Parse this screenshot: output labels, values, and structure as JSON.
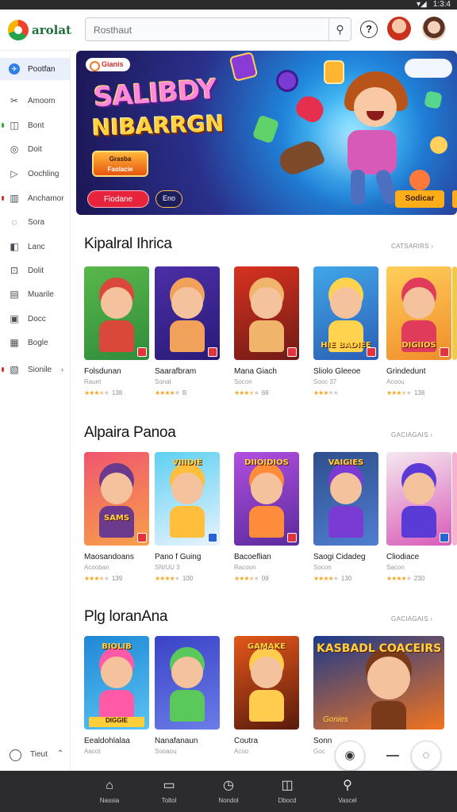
{
  "status_bar": {
    "time": "1:3:4",
    "signal": "▾◢"
  },
  "header": {
    "logo_text": "arolat",
    "search": {
      "placeholder": "Rosthaut",
      "button_icon": "person-search-icon"
    },
    "help_icon": "?",
    "avatars": [
      "avatar-red-hair",
      "avatar-brown-hair"
    ]
  },
  "sidebar": {
    "items": [
      {
        "label": "Pootfan",
        "icon": "✈",
        "active": true
      },
      {
        "label": "Amoom",
        "icon": "✂",
        "dot": ""
      },
      {
        "label": "Bont",
        "icon": "◫",
        "dot": "#3aaa35"
      },
      {
        "label": "Doit",
        "icon": "◎",
        "dot": ""
      },
      {
        "label": "Oochling",
        "icon": "▷",
        "dot": ""
      },
      {
        "label": "Anchamor",
        "icon": "▥",
        "dot": "#e03131"
      },
      {
        "label": "Sora",
        "icon": "◌",
        "dot": ""
      },
      {
        "label": "Lanc",
        "icon": "◧",
        "dot": ""
      },
      {
        "label": "Dolit",
        "icon": "⊡",
        "dot": ""
      },
      {
        "label": "Muarile",
        "icon": "▤",
        "dot": ""
      },
      {
        "label": "Docc",
        "icon": "▣",
        "dot": ""
      },
      {
        "label": "Bogle",
        "icon": "▦",
        "dot": ""
      },
      {
        "label": "Sionile",
        "icon": "▧",
        "dot": "#e03131",
        "chevron": "›"
      }
    ],
    "bottom": {
      "label": "Tieut",
      "chevron": "⌃"
    }
  },
  "hero": {
    "badge": "Gianis",
    "title_line1": "SALIBDY",
    "title_line2": "NIBARRGN",
    "pill_line1": "Grasba",
    "pill_line2": "Faolacie",
    "primary_button": "Fiodane",
    "secondary_button": "Eno",
    "right_button": "Sodicar"
  },
  "sections": [
    {
      "title": "Kipalral Ihrica",
      "see_all": "CATSARIRS ›",
      "cards": [
        {
          "name": "Folsdunan",
          "sub": "Rauet",
          "rating": 3.5,
          "count": "138",
          "theme": "green",
          "badge": "red"
        },
        {
          "name": "Saarafbram",
          "sub": "Sonat",
          "rating": 4.0,
          "count": "B",
          "theme": "purple",
          "badge": "red"
        },
        {
          "name": "Mana Giach",
          "sub": "Socon",
          "rating": 3.5,
          "count": "68",
          "theme": "red",
          "badge": "red"
        },
        {
          "name": "Sliolo Gleeoe",
          "sub": "Sooc 37",
          "rating": 3.0,
          "count": "",
          "theme": "blue",
          "badge": "red"
        },
        {
          "name": "Grindedunt",
          "sub": "Acoou",
          "rating": 3.5,
          "count": "138",
          "theme": "orange",
          "badge": "red"
        }
      ]
    },
    {
      "title": "Alpaira Panoa",
      "see_all": "GACIAGAIS ›",
      "cards": [
        {
          "name": "Maosandoans",
          "sub": "Acooban",
          "rating": 3.5,
          "count": "139",
          "theme": "sunset",
          "badge": "red"
        },
        {
          "name": "Pano f Guing",
          "sub": "SN/UU 3",
          "rating": 4.0,
          "count": "100",
          "theme": "sky",
          "badge": "blue"
        },
        {
          "name": "Bacoeflian",
          "sub": "Racoon",
          "rating": 3.5,
          "count": "09",
          "theme": "violet",
          "badge": "red"
        },
        {
          "name": "Saogi Cidadeg",
          "sub": "Socon",
          "rating": 4.0,
          "count": "130",
          "theme": "castle",
          "badge": ""
        },
        {
          "name": "Cliodiace",
          "sub": "Sacon",
          "rating": 4.0,
          "count": "230",
          "theme": "pink",
          "badge": "blue"
        }
      ]
    },
    {
      "title": "Plg loranAna",
      "see_all": "GACIAGAIS ›",
      "cards": [
        {
          "name": "Eealdohlalaa",
          "sub": "Aacot",
          "rating": 0,
          "count": "",
          "theme": "arcade",
          "badge": ""
        },
        {
          "name": "Nanafanaun",
          "sub": "Sooaou",
          "rating": 0,
          "count": "",
          "theme": "indigo",
          "badge": ""
        },
        {
          "name": "Coutra",
          "sub": "Acoo",
          "rating": 0,
          "count": "",
          "theme": "fire",
          "badge": ""
        },
        {
          "name": "Sonn",
          "sub": "Goc",
          "rating": 0,
          "count": "",
          "theme": "bear",
          "badge": ""
        }
      ]
    }
  ],
  "card_art_text": {
    "s1c5": "DIGIIOS",
    "s1c4": "HIE BADIEE",
    "s2c1": "SAMS",
    "s2c2": "VIIIDIE",
    "s2c3": "DIIOIDIOS",
    "s2c4": "VAIGIES",
    "s3c1": "BIOLIB",
    "s3c1b": "DIGGIE",
    "s3c3": "GAMAKE",
    "s3c4": "KASBADL COACEIRS",
    "s3c4b": "Gonies"
  },
  "bottom_nav": [
    {
      "label": "Nassia",
      "icon": "⌂"
    },
    {
      "label": "Toltol",
      "icon": "▭"
    },
    {
      "label": "Nondol",
      "icon": "◷"
    },
    {
      "label": "Dbocd",
      "icon": "◫"
    },
    {
      "label": "Vascel",
      "icon": "⚲"
    }
  ],
  "fabs": {
    "left_icon": "◉",
    "right_icon": "◌"
  },
  "colors": {
    "accent": "#2f7ee6",
    "hero_primary": "#e8243c",
    "hero_cta": "#ffae1a",
    "star": "#f5a623",
    "nav_bg": "#2c2c2e"
  }
}
